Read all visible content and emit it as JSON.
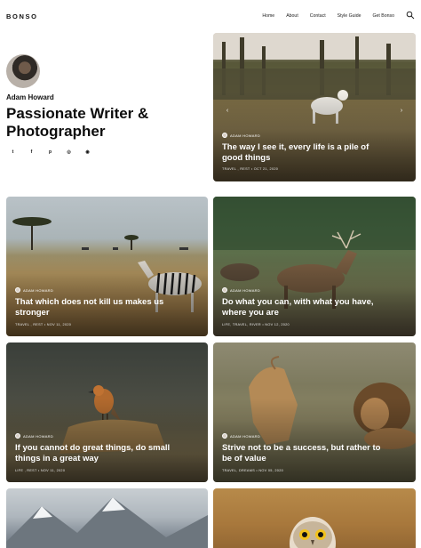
{
  "site": {
    "logo": "BONSO"
  },
  "nav": {
    "items": [
      "Home",
      "About",
      "Contact",
      "Style Guide",
      "Get Bonso"
    ],
    "search_icon": "search-icon"
  },
  "hero": {
    "author": "Adam Howard",
    "title": "Passionate Writer & Photographer",
    "socials": [
      {
        "icon": "twitter-icon",
        "glyph": "t"
      },
      {
        "icon": "facebook-icon",
        "glyph": "f"
      },
      {
        "icon": "pinterest-icon",
        "glyph": "p"
      },
      {
        "icon": "instagram-icon",
        "glyph": "◎"
      },
      {
        "icon": "github-icon",
        "glyph": "◉"
      }
    ]
  },
  "cards": [
    {
      "author": "ADAM HOWARD",
      "title": "The way I see it, every life is a pile of good things",
      "meta": "TRAVEL , REST  •  OCT 21, 2020",
      "scene": "wolf"
    },
    {
      "author": "ADAM HOWARD",
      "title": "That which does not kill us makes us stronger",
      "meta": "TRAVEL , REST  •  NOV 11, 2020",
      "scene": "zebra"
    },
    {
      "author": "ADAM HOWARD",
      "title": "Do what you can, with what you have, where you are",
      "meta": "LIFE, TRAVEL, RIVER  •  NOV 12, 2020",
      "scene": "deer"
    },
    {
      "author": "ADAM HOWARD",
      "title": "If you cannot do great things, do small things in a great way",
      "meta": "LIFE , REST  •  NOV 11, 2020",
      "scene": "bird"
    },
    {
      "author": "ADAM HOWARD",
      "title": "Strive not to be a success, but rather to be of value",
      "meta": "TRAVEL, DREAMS  •  NOV 05, 2020",
      "scene": "lion"
    }
  ]
}
